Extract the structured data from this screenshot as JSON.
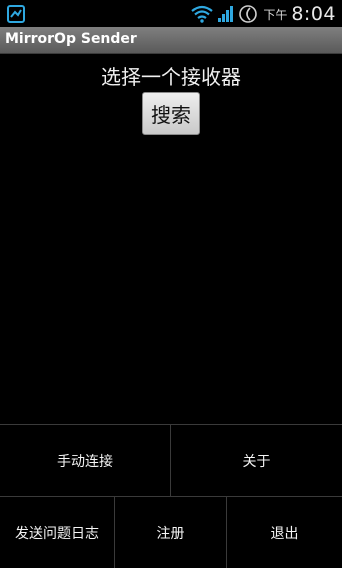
{
  "status_bar": {
    "ampm": "下午",
    "time": "8:04"
  },
  "title_bar": {
    "title": "MirrorOp Sender"
  },
  "main": {
    "heading": "选择一个接收器",
    "search_label": "搜索"
  },
  "menu": {
    "row1": [
      {
        "label": "手动连接"
      },
      {
        "label": "关于"
      }
    ],
    "row2": [
      {
        "label": "发送问题日志"
      },
      {
        "label": "注册"
      },
      {
        "label": "退出"
      }
    ]
  },
  "colors": {
    "status_icons": "#2fa8e0",
    "background": "#000000"
  }
}
